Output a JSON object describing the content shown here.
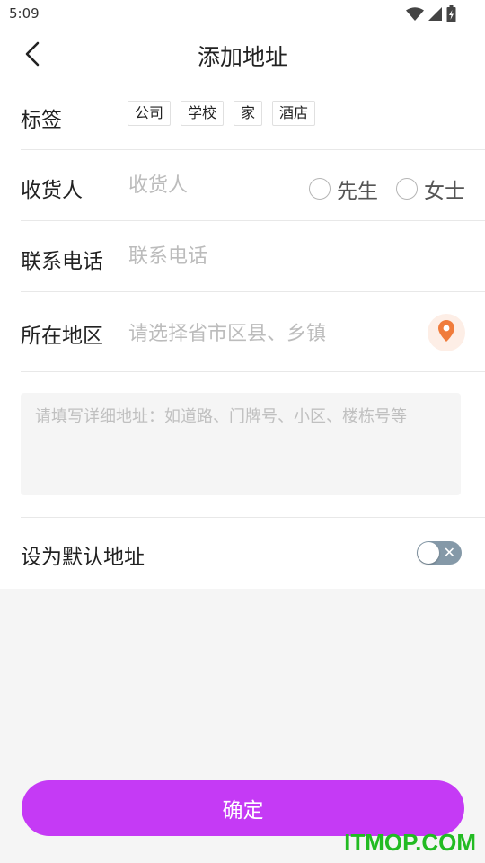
{
  "status_bar": {
    "time": "5:09",
    "icons": [
      "wifi-icon",
      "cell-signal-icon",
      "battery-icon"
    ]
  },
  "header": {
    "title": "添加地址",
    "back_icon": "chevron-left-icon"
  },
  "tags_row": {
    "label": "标签",
    "tags": [
      "公司",
      "学校",
      "家",
      "酒店"
    ]
  },
  "recipient_row": {
    "label": "收货人",
    "placeholder": "收货人",
    "value": "",
    "options": [
      {
        "label": "先生",
        "selected": false
      },
      {
        "label": "女士",
        "selected": false
      }
    ]
  },
  "phone_row": {
    "label": "联系电话",
    "placeholder": "联系电话",
    "value": ""
  },
  "region_row": {
    "label": "所在地区",
    "placeholder": "请选择省市区县、乡镇",
    "location_icon": "location-pin-icon"
  },
  "address": {
    "placeholder": "请填写详细地址：如道路、门牌号、小区、楼栋号等",
    "value": ""
  },
  "default_row": {
    "label": "设为默认地址",
    "enabled": false
  },
  "confirm_button": {
    "label": "确定"
  },
  "watermark": "ITMOP.COM",
  "colors": {
    "accent": "#c53af5",
    "location_pin": "#f07c3c",
    "location_bg": "#fdeee6",
    "toggle_off": "#8599a8",
    "watermark": "#22bb22"
  }
}
